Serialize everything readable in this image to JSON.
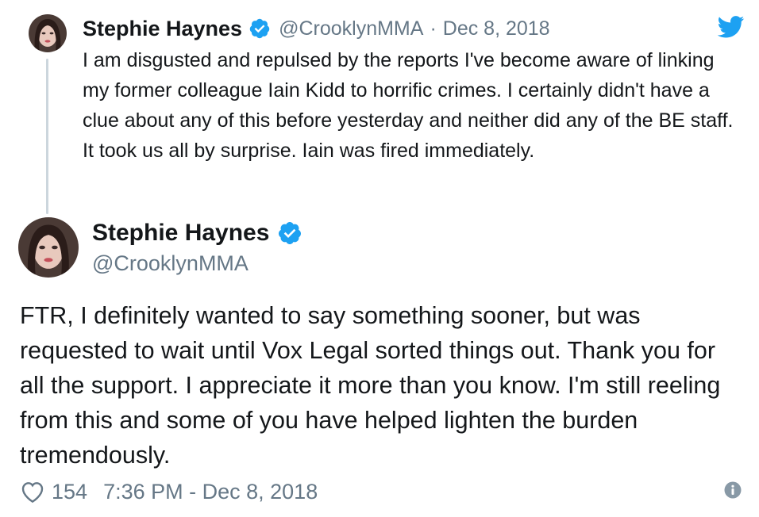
{
  "parent_tweet": {
    "name": "Stephie Haynes",
    "handle": "@CrooklynMMA",
    "separator": "·",
    "date": "Dec 8, 2018",
    "text": "I am disgusted and repulsed by the reports I've become aware of linking my former colleague Iain Kidd to horrific crimes. I certainly didn't have a clue about any of this before yesterday and neither did any of the BE staff. It took us all by surprise. Iain was fired immediately."
  },
  "main_tweet": {
    "name": "Stephie Haynes",
    "handle": "@CrooklynMMA",
    "text": "FTR, I definitely wanted to say something sooner, but was requested to wait until Vox Legal sorted things out. Thank you for all the support. I appreciate it more than you know. I'm still reeling from this and some of you have helped lighten the burden tremendously.",
    "like_count": "154",
    "timestamp": "7:36 PM - Dec 8, 2018"
  },
  "icons": {
    "verified": "verified-badge-icon",
    "brand": "twitter-bird-icon",
    "like": "heart-icon",
    "info": "info-icon"
  },
  "colors": {
    "twitter_blue": "#1da1f2",
    "secondary_text": "#657786",
    "thread_line": "#ccd6dd"
  }
}
